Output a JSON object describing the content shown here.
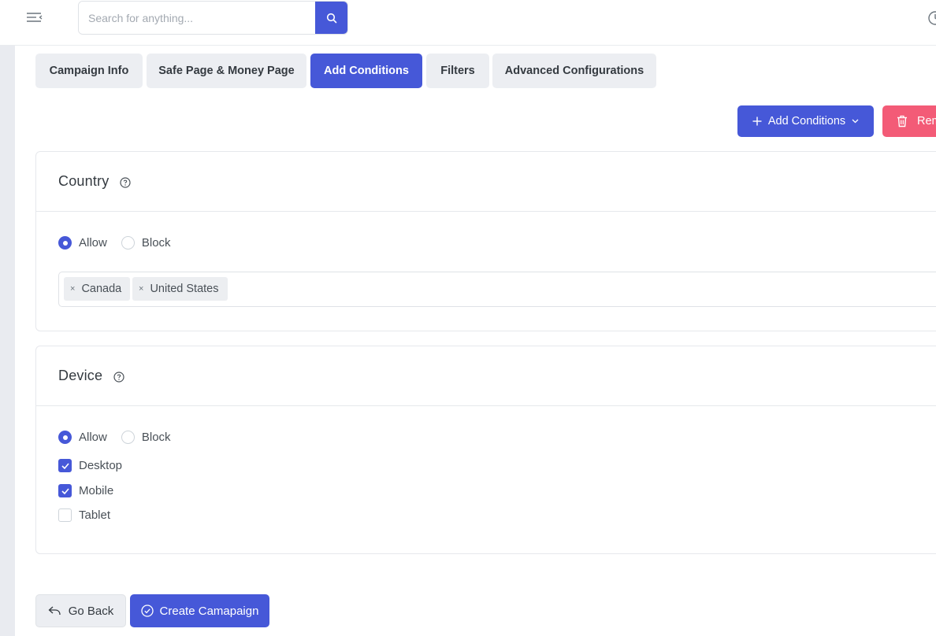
{
  "header": {
    "search_placeholder": "Search for anything...",
    "menu_icon": "menu-collapse-icon",
    "search_icon": "search-icon",
    "clock_icon": "clock-icon"
  },
  "tabs": [
    {
      "label": "Campaign Info",
      "active": false
    },
    {
      "label": "Safe Page & Money Page",
      "active": false
    },
    {
      "label": "Add Conditions",
      "active": true
    },
    {
      "label": "Filters",
      "active": false
    },
    {
      "label": "Advanced Configurations",
      "active": false
    }
  ],
  "actions": {
    "add_conditions_label": "Add Conditions",
    "remove_label": "Remove"
  },
  "country": {
    "title": "Country",
    "allow_label": "Allow",
    "block_label": "Block",
    "selected_mode": "Allow",
    "tags": [
      "Canada",
      "United States"
    ]
  },
  "device": {
    "title": "Device",
    "allow_label": "Allow",
    "block_label": "Block",
    "selected_mode": "Allow",
    "options": [
      {
        "label": "Desktop",
        "checked": true
      },
      {
        "label": "Mobile",
        "checked": true
      },
      {
        "label": "Tablet",
        "checked": false
      }
    ]
  },
  "footer": {
    "back_label": "Go Back",
    "create_label": "Create Camapaign"
  },
  "colors": {
    "primary": "#4658d8",
    "danger": "#f35b77",
    "tab_bg": "#eceef2"
  }
}
